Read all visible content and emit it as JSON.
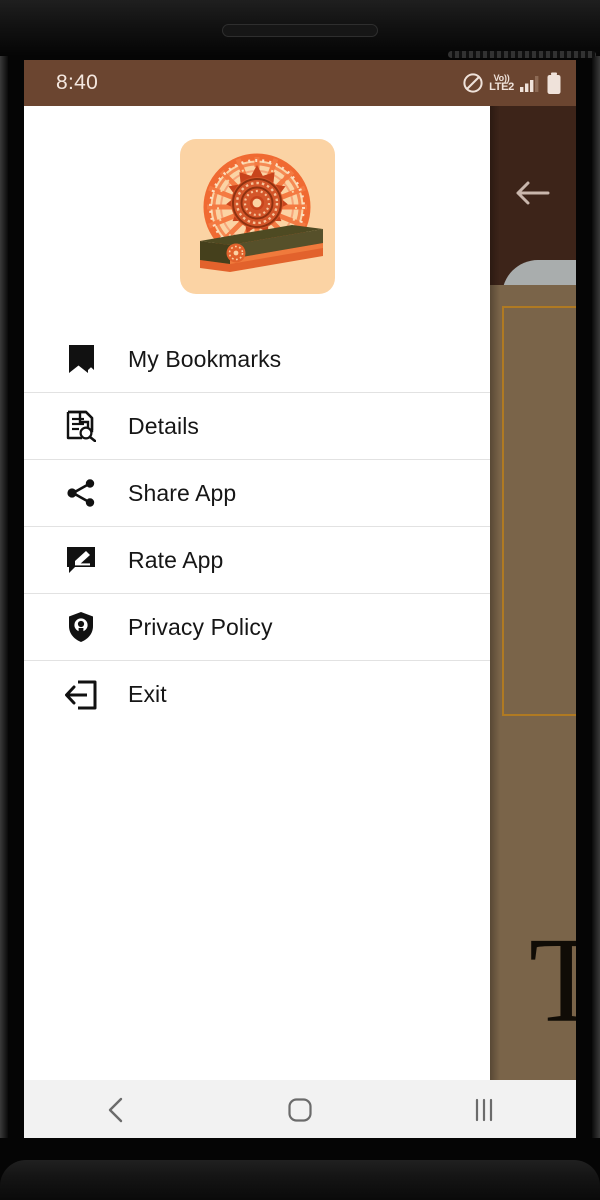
{
  "statusbar": {
    "time": "8:40",
    "volte_top": "Vo))",
    "volte_bottom": "LTE2",
    "mute_icon": "no-sound-icon",
    "signal_icon": "signal-bars-icon",
    "battery_icon": "battery-full-icon",
    "background_color": "#6B4530",
    "text_color": "#F4E7DF"
  },
  "drawer": {
    "app_icon_name": "app-logo-dharma-wheel-book",
    "app_icon_background": "#FBD3A4",
    "items": [
      {
        "label": "My Bookmarks",
        "icon": "bookmark-icon"
      },
      {
        "label": "Details",
        "icon": "document-search-icon"
      },
      {
        "label": "Share App",
        "icon": "share-nodes-icon"
      },
      {
        "label": "Rate App",
        "icon": "rate-review-icon"
      },
      {
        "label": "Privacy Policy",
        "icon": "shield-privacy-icon"
      },
      {
        "label": "Exit",
        "icon": "logout-icon"
      }
    ],
    "background_color": "#FFFFFF",
    "divider_color": "#E2E2E2",
    "text_color": "#161616"
  },
  "background_app": {
    "appbar_color": "#3D2419",
    "content_color": "#7A6449",
    "border_color": "#B07A22",
    "back_icon": "back-arrow-icon",
    "share_button_icon": "share-forward-arrow-icon",
    "share_button_color": "#A9ADAD",
    "page_letter": "T"
  },
  "navbar": {
    "background_color": "#F2F2F2",
    "buttons": [
      {
        "name": "back-nav-button",
        "icon": "chevron-left-icon"
      },
      {
        "name": "home-nav-button",
        "icon": "home-square-icon"
      },
      {
        "name": "recents-nav-button",
        "icon": "recents-bars-icon"
      }
    ]
  },
  "device": {
    "speaker_name": "earpiece-speaker-grille"
  }
}
